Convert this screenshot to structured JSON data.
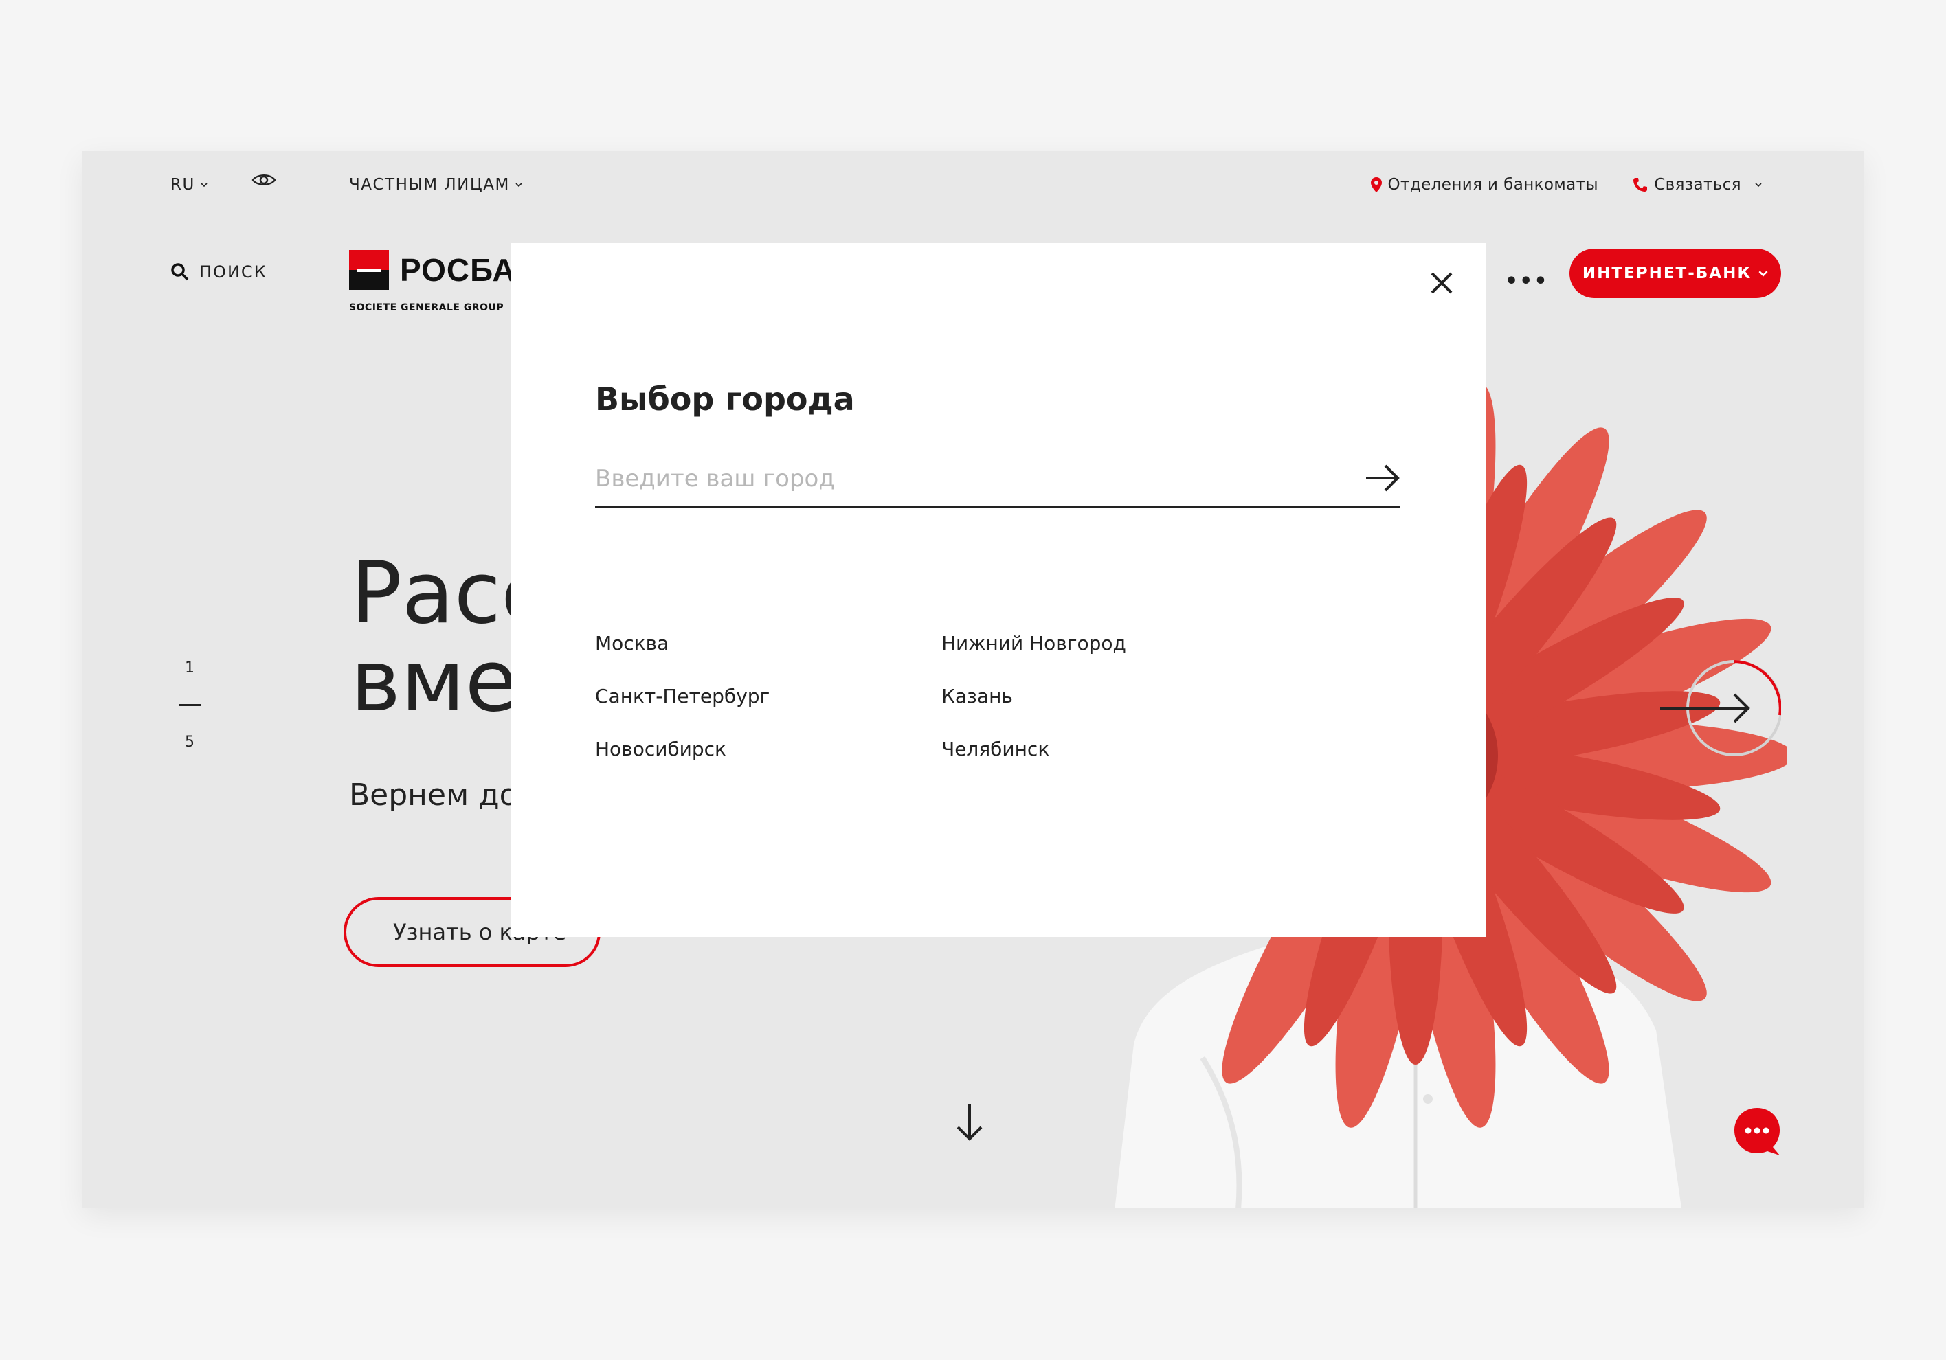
{
  "header": {
    "lang": "RU",
    "segment": "ЧАСТНЫМ ЛИЦАМ",
    "branches": "Отделения и банкоматы",
    "contact": "Связаться",
    "search": "ПОИСК",
    "logo_name": "РОСБА",
    "logo_sub": "SOCIETE GENERALE GROUP",
    "more": "•••",
    "internet_bank": "ИНТЕРНЕТ-БАНК"
  },
  "hero": {
    "title_line1": "Расс",
    "title_line2": "вмес",
    "subtitle": "Вернем до",
    "button": "Узнать о карте",
    "pager_current": "1",
    "pager_total": "5"
  },
  "modal": {
    "title": "Выбор города",
    "input_placeholder": "Введите ваш город",
    "input_value": "",
    "cities": [
      {
        "name": "Москва"
      },
      {
        "name": "Нижний Новгород"
      },
      {
        "name": "Санкт-Петербург"
      },
      {
        "name": "Казань"
      },
      {
        "name": "Новосибирск"
      },
      {
        "name": "Челябинск"
      }
    ]
  },
  "colors": {
    "accent": "#e30613",
    "background": "#e8e8e8",
    "modal": "#ffffff",
    "text": "#222222",
    "placeholder": "#b7b7b7"
  },
  "icons": {
    "eye": "eye-icon",
    "pin": "location-pin-icon",
    "phone": "phone-icon",
    "search": "search-icon",
    "close": "close-icon",
    "arrow_right": "arrow-right-icon",
    "arrow_down": "arrow-down-icon",
    "chat": "chat-icon"
  }
}
